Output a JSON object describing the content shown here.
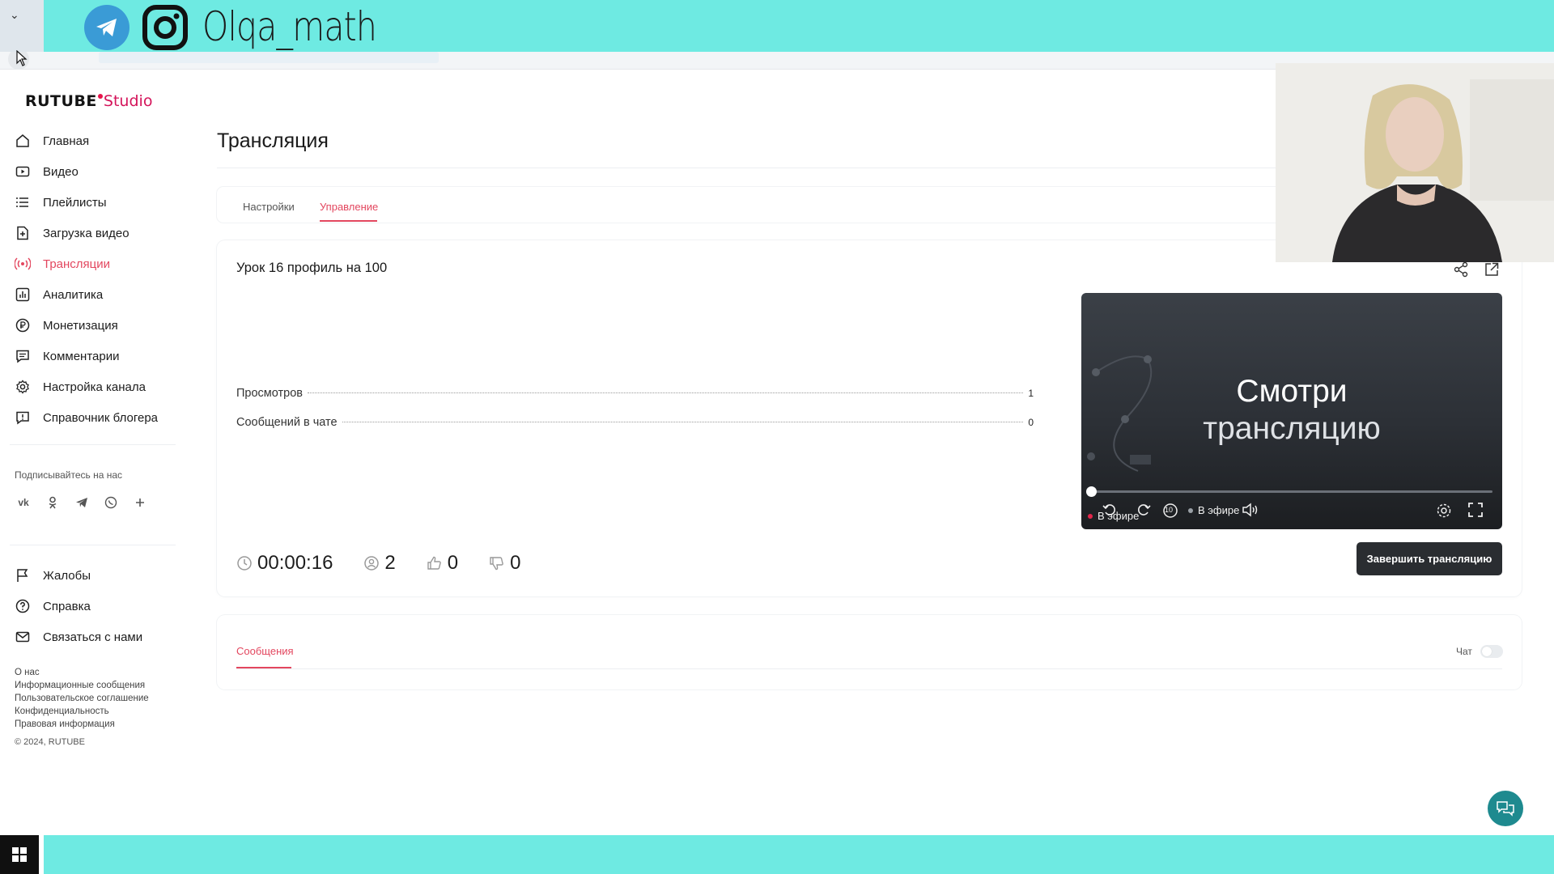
{
  "overlay": {
    "handle": "Olqa_math",
    "colors": {
      "banner": "#6eeae2",
      "telegram": "#3a9bd6"
    }
  },
  "sidebar": {
    "logo_main": "RUTUBE",
    "logo_sub": "Studio",
    "items": [
      {
        "label": "Главная",
        "icon": "home-icon"
      },
      {
        "label": "Видео",
        "icon": "video-icon"
      },
      {
        "label": "Плейлисты",
        "icon": "list-icon"
      },
      {
        "label": "Загрузка видео",
        "icon": "upload-file-icon"
      },
      {
        "label": "Трансляции",
        "icon": "broadcast-icon",
        "active": true
      },
      {
        "label": "Аналитика",
        "icon": "chart-icon"
      },
      {
        "label": "Монетизация",
        "icon": "ruble-icon"
      },
      {
        "label": "Комментарии",
        "icon": "comments-icon"
      },
      {
        "label": "Настройка канала",
        "icon": "gear-icon"
      },
      {
        "label": "Справочник блогера",
        "icon": "info-icon"
      }
    ],
    "subscribe_label": "Подписывайтесь на нас",
    "socials": [
      "vk-icon",
      "ok-icon",
      "telegram-icon",
      "viber-icon",
      "plus-icon"
    ],
    "secondary_items": [
      {
        "label": "Жалобы",
        "icon": "flag-icon"
      },
      {
        "label": "Справка",
        "icon": "help-icon"
      },
      {
        "label": "Связаться с нами",
        "icon": "mail-icon"
      }
    ],
    "footer_links": [
      "О нас",
      "Информационные сообщения",
      "Пользовательское соглашение",
      "Конфиденциальность",
      "Правовая информация"
    ],
    "copyright": "© 2024, RUTUBE"
  },
  "main": {
    "title": "Трансляция",
    "tabs": [
      {
        "label": "Настройки",
        "active": false
      },
      {
        "label": "Управление",
        "active": true
      }
    ],
    "stream": {
      "name": "Урок 16 профиль на 100",
      "stats": [
        {
          "label": "Просмотров",
          "value": "1"
        },
        {
          "label": "Сообщений в чате",
          "value": "0"
        }
      ],
      "metrics": {
        "duration": "00:00:16",
        "viewers": "2",
        "likes": "0",
        "dislikes": "0"
      },
      "player": {
        "line1": "Смотри",
        "line2": "трансляцию",
        "live_label": "В эфире",
        "live_label_2": "В эфире",
        "skip_label": "10"
      },
      "end_button": "Завершить трансляцию"
    },
    "messages": {
      "tab_label": "Сообщения",
      "chat_label": "Чат",
      "chat_enabled": false
    },
    "accent_color": "#e3475f"
  }
}
